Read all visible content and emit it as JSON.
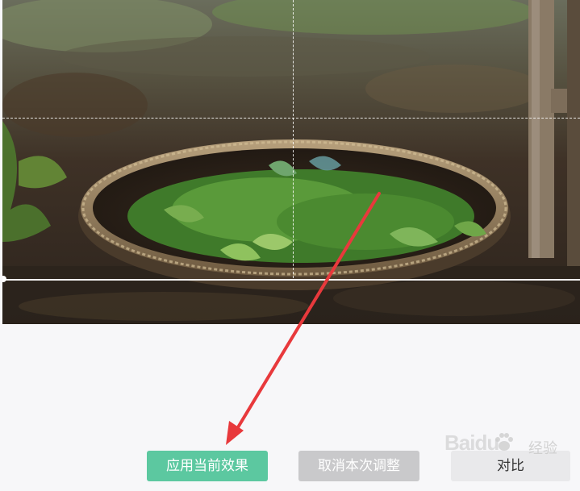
{
  "photo": {
    "subject": "basket of fresh green herbs on the ground"
  },
  "buttons": {
    "apply_label": "应用当前效果",
    "cancel_label": "取消本次调整",
    "compare_label": "对比"
  },
  "watermark": {
    "brand": "Baidu",
    "cn": "经验"
  },
  "colors": {
    "apply_bg": "#5cc8a0",
    "cancel_bg": "#c9c9cb",
    "compare_bg": "#e9e9eb",
    "arrow": "#e8393c"
  },
  "icons": {
    "watermark_paw": "paw-icon"
  }
}
